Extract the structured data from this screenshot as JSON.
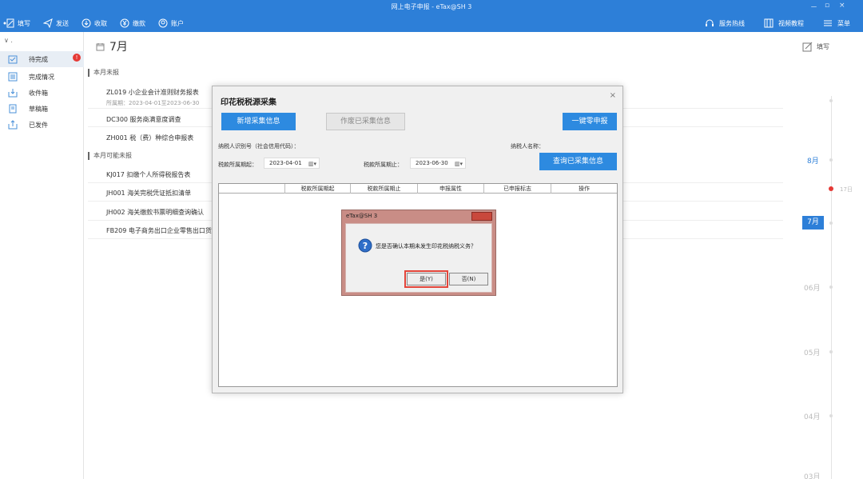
{
  "window": {
    "title": "网上电子申报 - eTax@SH 3",
    "controls": [
      "－",
      "▫",
      "×"
    ]
  },
  "toolbar": {
    "items": [
      "填写",
      "发送",
      "收取",
      "缴款",
      "账户"
    ],
    "right": [
      "服务热线",
      "视频教程",
      "菜单"
    ]
  },
  "sidebar": {
    "toggle": "∨ .",
    "items": [
      {
        "label": "待完成",
        "badge": "!"
      },
      {
        "label": "完成情况"
      },
      {
        "label": "收件箱"
      },
      {
        "label": "草稿箱"
      },
      {
        "label": "已发件"
      }
    ]
  },
  "main": {
    "month": "7月",
    "fill_label": "填写",
    "section_unreported": "本月未报",
    "section_possible": "本月可能未报",
    "tasks_unreported": [
      {
        "title": "ZL019 小企业会计准则财务报表",
        "sub": "所属期：2023-04-01至2023-06-30"
      },
      {
        "title": "DC300 服务商满意度调查"
      },
      {
        "title": "ZH001 税（费）种综合申报表"
      }
    ],
    "tasks_possible": [
      {
        "title": "KJ017 扣缴个人所得税报告表"
      },
      {
        "title": "JH001 海关完税凭证抵扣清单"
      },
      {
        "title": "JH002 海关缴款书票明细查询确认"
      },
      {
        "title": "FB209 电子商务出口企业零售出口货物"
      }
    ]
  },
  "timeline": {
    "months": [
      "8月",
      "06月",
      "05月",
      "04月",
      "03月"
    ],
    "current": "7月",
    "dot_label": "17日"
  },
  "dialog": {
    "title": "印花税税源采集",
    "close": "×",
    "btn_add": "新增采集信息",
    "btn_void": "作废已采集信息",
    "btn_zero": "一键零申报",
    "btn_query": "查询已采集信息",
    "taxpayer_id_label": "纳税人识别号（社会信用代码）：",
    "taxpayer_name_label": "纳税人名称：",
    "period_start_label": "税款所属期起：",
    "period_start": "2023-04-01",
    "period_end_label": "税款所属期止：",
    "period_end": "2023-06-30",
    "columns": [
      "税款所属期起",
      "税款所属期止",
      "申报属性",
      "已申报标志",
      "操作"
    ]
  },
  "msgbox": {
    "title": "eTax@SH 3",
    "text": "您是否确认本期未发生印花税纳税义务？",
    "yes": "是(Y)",
    "no": "否(N)"
  }
}
